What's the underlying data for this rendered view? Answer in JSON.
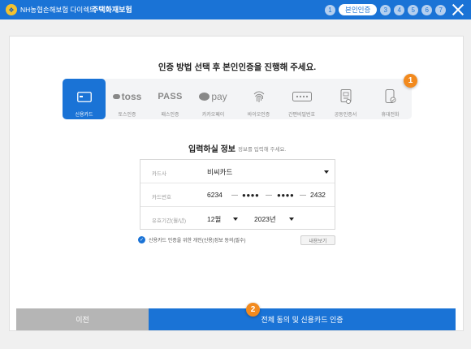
{
  "header": {
    "brand": "NH농협손해보험 다이렉트",
    "product": "주택화재보험",
    "steps": [
      "1",
      "본인인증",
      "3",
      "4",
      "5",
      "6",
      "7"
    ],
    "colors": {
      "bar": "#1a73d6",
      "badge": "#f28a1e"
    }
  },
  "main": {
    "title": "인증 방법 선택 후 본인인증을 진행해 주세요.",
    "methods": [
      {
        "label": "신용카드",
        "icon": "credit-card-icon",
        "selected": true
      },
      {
        "label": "토스인증",
        "icon": "toss-logo",
        "logo_text": "toss"
      },
      {
        "label": "패스인증",
        "icon": "pass-logo",
        "logo_text": "PASS"
      },
      {
        "label": "카카오페이",
        "icon": "kakaopay-logo",
        "logo_text": "pay"
      },
      {
        "label": "바이오인증",
        "icon": "fingerprint-icon"
      },
      {
        "label": "간편비밀번호",
        "icon": "pin-icon"
      },
      {
        "label": "공동인증서",
        "icon": "certificate-icon"
      },
      {
        "label": "휴대전화",
        "icon": "phone-icon"
      }
    ],
    "badge1": "1",
    "badge2": "2"
  },
  "form": {
    "title": "입력하실 정보",
    "subtitle": "정보를 입력해 주세요.",
    "card_company": {
      "label": "카드사",
      "value": "비씨카드"
    },
    "card_number": {
      "label": "카드번호",
      "part1": "6234",
      "part2": "●●●●",
      "part3": "●●●●",
      "part4": "2432"
    },
    "expiry": {
      "label": "유효기간(월/년)",
      "month": "12월",
      "year": "2023년"
    }
  },
  "consent": {
    "text": "신용카드 인증을 위한 개인(신용)정보 동의(필수)",
    "view_button": "내용보기"
  },
  "buttons": {
    "prev": "이전",
    "confirm": "전체 동의 및 신용카드 인증"
  }
}
